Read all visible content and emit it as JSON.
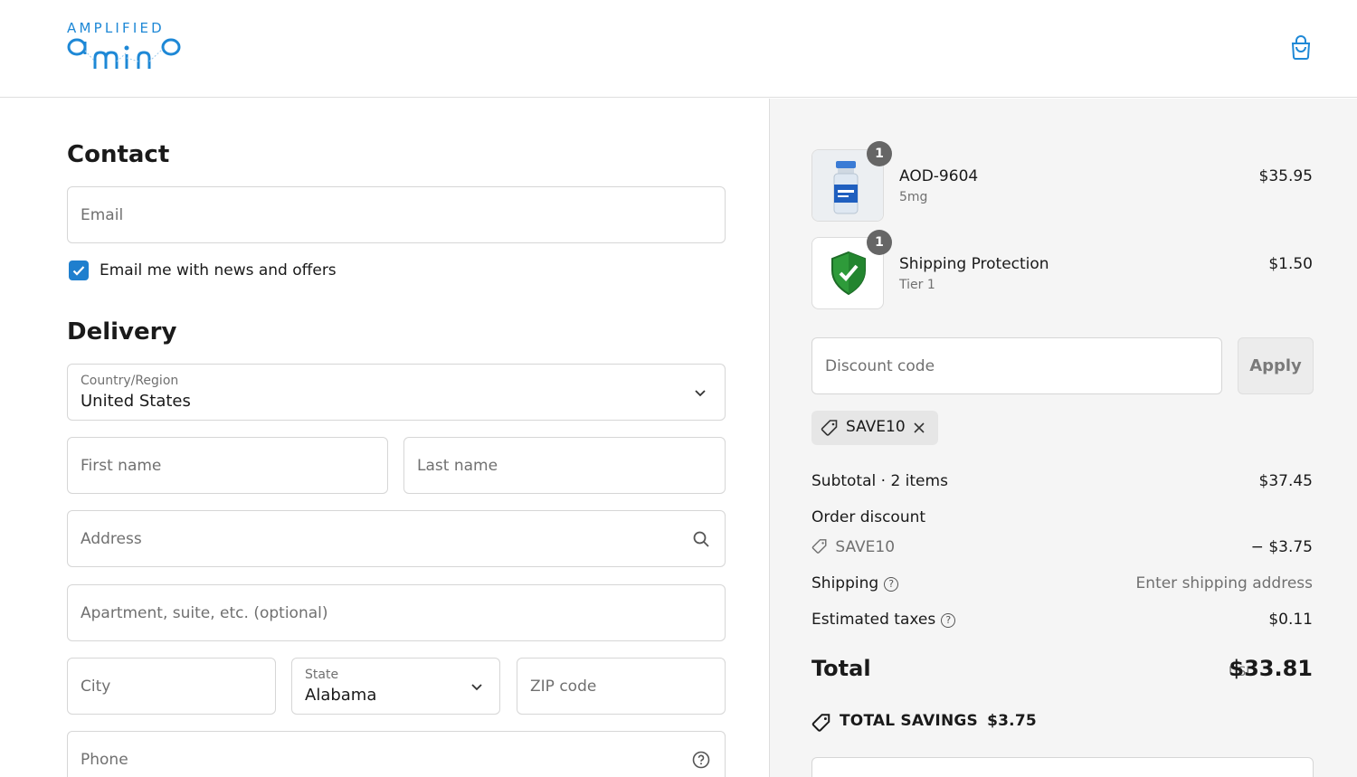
{
  "brand": {
    "logo_top": "AMPLIFIED",
    "logo_bottom": "amino",
    "accent": "#1e88d6"
  },
  "contact": {
    "heading": "Contact",
    "email_placeholder": "Email",
    "newsletter_label": "Email me with news and offers",
    "newsletter_checked": true
  },
  "delivery": {
    "heading": "Delivery",
    "country_label": "Country/Region",
    "country_value": "United States",
    "first_name_placeholder": "First name",
    "last_name_placeholder": "Last name",
    "address_placeholder": "Address",
    "apartment_placeholder": "Apartment, suite, etc. (optional)",
    "city_placeholder": "City",
    "state_label": "State",
    "state_value": "Alabama",
    "zip_placeholder": "ZIP code",
    "phone_placeholder": "Phone"
  },
  "cart": {
    "items": [
      {
        "name": "AOD-9604",
        "variant": "5mg",
        "price": "$35.95",
        "qty": "1",
        "icon": "vial-icon"
      },
      {
        "name": "Shipping Protection",
        "variant": "Tier 1",
        "price": "$1.50",
        "qty": "1",
        "icon": "shield-check-icon"
      }
    ],
    "discount_placeholder": "Discount code",
    "apply_label": "Apply",
    "applied_code": "SAVE10"
  },
  "summary": {
    "subtotal_label": "Subtotal · 2 items",
    "subtotal_value": "$37.45",
    "order_discount_label": "Order discount",
    "discount_code": "SAVE10",
    "discount_value": "− $3.75",
    "shipping_label": "Shipping",
    "shipping_value": "Enter shipping address",
    "taxes_label": "Estimated taxes",
    "taxes_value": "$0.11",
    "total_label": "Total",
    "currency": "USD",
    "total_value": "$33.81",
    "savings_label": "TOTAL SAVINGS",
    "savings_value": "$3.75"
  }
}
